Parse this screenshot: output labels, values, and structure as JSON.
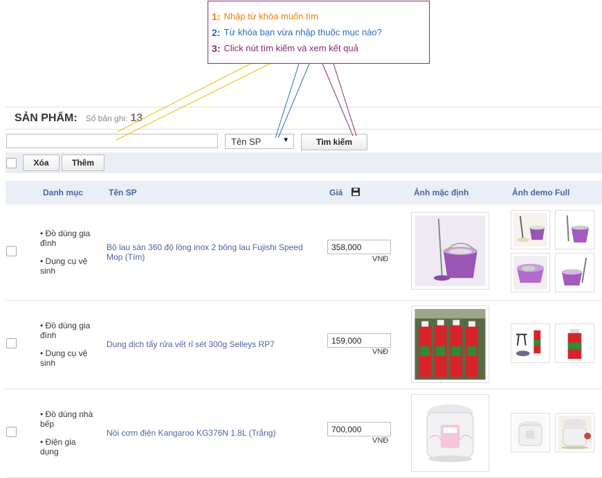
{
  "callout": {
    "steps": [
      {
        "num": "1:",
        "text": "Nhập từ khóa muốn  tìm",
        "color": "#f07d00"
      },
      {
        "num": "2:",
        "text": "Từ khóa bạn vừa nhập thuộc mục nào?",
        "color": "#2a6bc0"
      },
      {
        "num": "3:",
        "text": "Click nút tìm kiếm và xem kết quả",
        "color": "#8a2a6a"
      }
    ]
  },
  "header": {
    "title": "SẢN PHẨM:",
    "count_label": "Số bản ghi:",
    "count": "13"
  },
  "search": {
    "value": "",
    "field_select": "Tên SP",
    "button_label": "Tìm kiếm"
  },
  "toolbar": {
    "delete_label": "Xóa",
    "add_label": "Thêm"
  },
  "table": {
    "headers": {
      "category": "Danh mục",
      "name": "Tên SP",
      "price": "Giá",
      "default_image": "Ảnh mặc định",
      "demo_images": "Ảnh demo Full"
    },
    "rows": [
      {
        "categories": [
          "• Đồ dùng gia đình",
          "• Dụng cụ vệ sinh"
        ],
        "name": "Bộ lau sàn 360 độ lồng inox 2 bông lau Fujishi Speed Mop (Tím)",
        "price": "358,000",
        "unit": "VNĐ",
        "main_image": "purple-spin-mop-bucket",
        "demo_images": [
          "mop-set-1",
          "mop-set-2",
          "mop-bucket-3",
          "mop-bucket-4"
        ]
      },
      {
        "categories": [
          "• Đồ dùng gia đình",
          "• Dụng cụ vệ sinh"
        ],
        "name": "Dung dịch tẩy rửa vết rỉ sét 300g Selleys RP7",
        "price": "159,000",
        "unit": "VNĐ",
        "main_image": "rp7-spray-cans",
        "demo_images": [
          "rp7-usage",
          "rp7-can"
        ]
      },
      {
        "categories": [
          "• Đồ dùng nhà bếp",
          "• Điện gia dụng"
        ],
        "name": "Nồi cơm điện Kangaroo KG376N 1.8L (Trắng)",
        "price": "700,000",
        "unit": "VNĐ",
        "main_image": "rice-cooker",
        "demo_images": [
          "rice-cooker-front",
          "rice-cooker-open"
        ]
      }
    ]
  }
}
